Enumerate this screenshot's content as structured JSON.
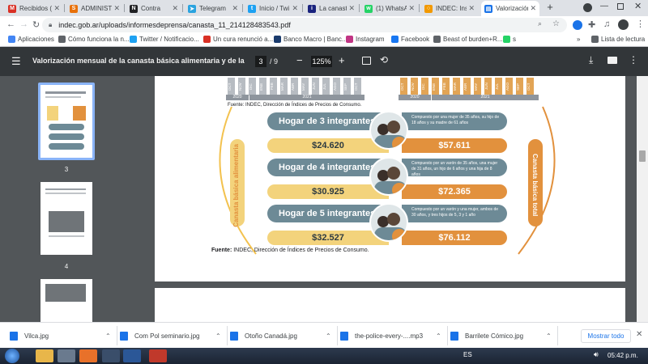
{
  "tabs": [
    {
      "label": "Recibidos (",
      "color": "#d93025",
      "glyph": "M"
    },
    {
      "label": "ADMINISTR",
      "color": "#e8710a",
      "glyph": "S"
    },
    {
      "label": "Contra",
      "color": "#202124",
      "glyph": "N"
    },
    {
      "label": "Telegram",
      "color": "#2aa3df",
      "glyph": "➤"
    },
    {
      "label": "Inicio / Twi",
      "color": "#1da1f2",
      "glyph": "t"
    },
    {
      "label": "La canasta",
      "color": "#1a237e",
      "glyph": "i"
    },
    {
      "label": "(1) WhatsAp",
      "color": "#25d366",
      "glyph": "w"
    },
    {
      "label": "INDEC: Insti",
      "color": "#f29900",
      "glyph": "○"
    },
    {
      "label": "Valorización",
      "color": "#1a73e8",
      "glyph": "▤"
    }
  ],
  "url": "indec.gob.ar/uploads/informesdeprensa/canasta_11_214128483543.pdf",
  "bookmarks": [
    {
      "label": "Aplicaciones",
      "color": "#4285f4"
    },
    {
      "label": "Cómo funciona la n...",
      "color": "#5f6368"
    },
    {
      "label": "Twitter / Notificacio...",
      "color": "#1da1f2"
    },
    {
      "label": "Un cura renunció a...",
      "color": "#d93025"
    },
    {
      "label": "Banco Macro | Banc...",
      "color": "#1a3b6d"
    },
    {
      "label": "Instagram",
      "color": "#c13584"
    },
    {
      "label": "Facebook",
      "color": "#1877f2"
    },
    {
      "label": "Beast of burden+R...",
      "color": "#5f6368"
    },
    {
      "label": "s",
      "color": "#25d366"
    }
  ],
  "bookmarks_more": "»",
  "reading_list": "Lista de lectura",
  "pdf": {
    "title": "Valorización mensual de la canasta básica alimentaria y de la canasta ...",
    "page": "3",
    "pages": "/ 9",
    "zoom": "125%"
  },
  "thumbnails": [
    "3",
    "4"
  ],
  "infographic": {
    "months_left": [
      "OCT",
      "NOV",
      "DIC",
      "ENE",
      "FEB",
      "MAR",
      "ABR",
      "MAY",
      "JUN",
      "JUL",
      "AGO",
      "SEP",
      "OCT"
    ],
    "months_right": [
      "OCT",
      "NOV",
      "DIC",
      "ENE",
      "FEB",
      "MAR",
      "ABR",
      "MAY",
      "JUN",
      "JUL",
      "AGO",
      "SEP",
      "OCT"
    ],
    "year_left_a": "2020",
    "year_left_b": "2021",
    "year_right_a": "2020",
    "year_right_b": "2021",
    "fuente_top": "Fuente: INDEC, Dirección de Índices de Precios de Consumo.",
    "label_cba": "Canasta básica alimentaria",
    "label_cbt": "Canasta básica total",
    "rows": [
      {
        "title": "Hogar de 3 integrantes",
        "desc": "Compuesto por una mujer de 35 años, su hijo de 18 años y su madre de 61 años",
        "cba": "$24.620",
        "cbt": "$57.611"
      },
      {
        "title": "Hogar de 4 integrantes",
        "desc": "Compuesto por un varón de 35 años, una mujer de 31 años, un hijo de 6 años y una hija de 8 años",
        "cba": "$30.925",
        "cbt": "$72.365"
      },
      {
        "title": "Hogar de 5 integrantes",
        "desc": "Compuesto por un varón y una mujer, ambos de 30 años, y tres hijos de 5, 3 y 1 año",
        "cba": "$32.527",
        "cbt": "$76.112"
      }
    ],
    "fuente_bottom_bold": "Fuente:",
    "fuente_bottom": "INDEC, Dirección de Índices de Precios de Consumo."
  },
  "downloads": [
    "Vilca.jpg",
    "Com Pol seminario.jpg",
    "Otoño Canadá.jpg",
    "the-police-every-....mp3",
    "Barrilete Cómico.jpg"
  ],
  "show_all": "Mostrar todo",
  "taskbar": {
    "lang": "ES",
    "time": "05:42 p.m."
  }
}
